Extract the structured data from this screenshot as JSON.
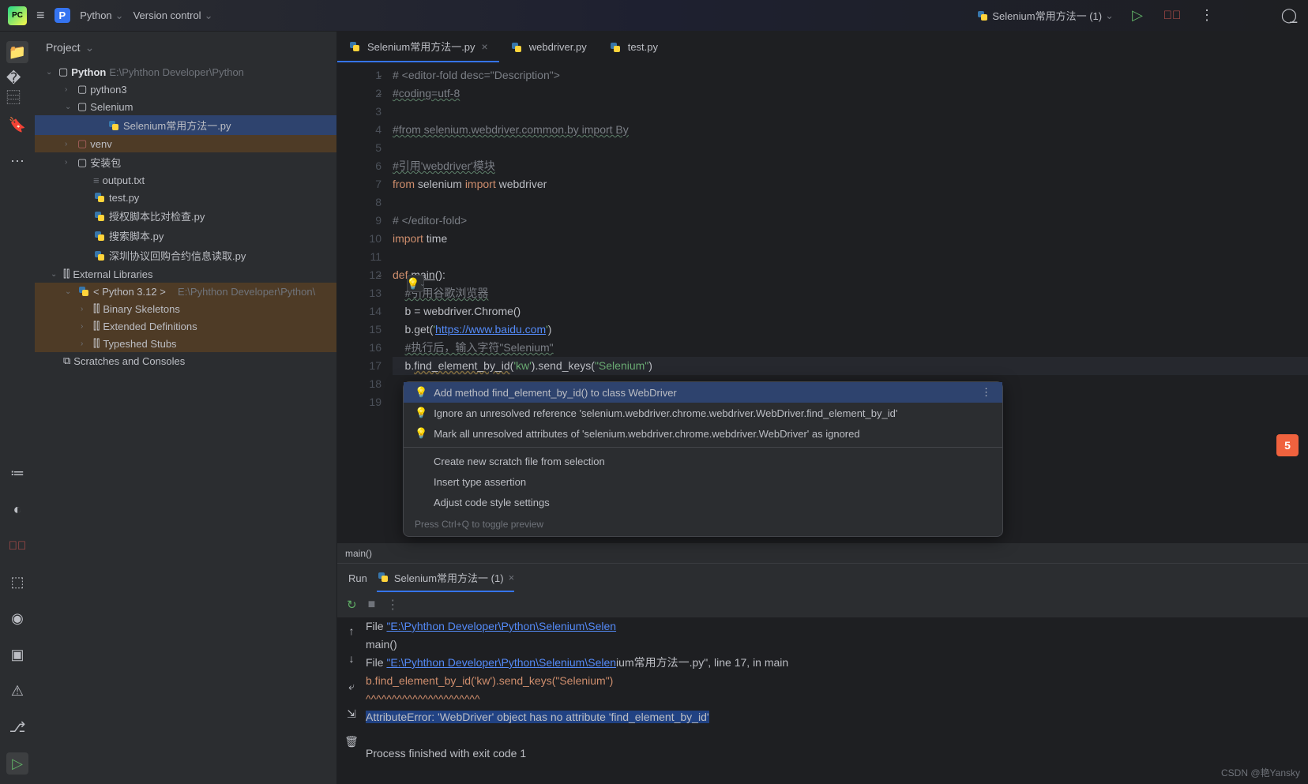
{
  "topbar": {
    "project_badge": "P",
    "project_name": "Python",
    "vcs": "Version control",
    "run_config": "Selenium常用方法一 (1)"
  },
  "project_panel": {
    "title": "Project",
    "root_name": "Python",
    "root_path": "E:\\Pyhthon Developer\\Python",
    "items": [
      {
        "indent": 24,
        "chevron": "›",
        "icon": "folder",
        "name": "python3"
      },
      {
        "indent": 24,
        "chevron": "⌄",
        "icon": "folder",
        "name": "Selenium"
      },
      {
        "indent": 62,
        "chevron": "",
        "icon": "py",
        "name": "Selenium常用方法一.py",
        "selected": true
      },
      {
        "indent": 24,
        "chevron": "›",
        "icon": "folder-excl",
        "name": "venv",
        "highlight": true
      },
      {
        "indent": 24,
        "chevron": "›",
        "icon": "folder",
        "name": "安装包"
      },
      {
        "indent": 44,
        "chevron": "",
        "icon": "txt",
        "name": "output.txt"
      },
      {
        "indent": 44,
        "chevron": "",
        "icon": "py",
        "name": "test.py"
      },
      {
        "indent": 44,
        "chevron": "",
        "icon": "py",
        "name": "授权脚本比对检查.py"
      },
      {
        "indent": 44,
        "chevron": "",
        "icon": "py",
        "name": "搜索脚本.py"
      },
      {
        "indent": 44,
        "chevron": "",
        "icon": "py",
        "name": "深圳协议回购合约信息读取.py"
      },
      {
        "indent": 6,
        "chevron": "⌄",
        "icon": "lib",
        "name": "External Libraries"
      },
      {
        "indent": 24,
        "chevron": "⌄",
        "icon": "py",
        "name": "< Python 3.12 >",
        "path": "E:\\Pyhthon Developer\\Python\\",
        "highlight": true
      },
      {
        "indent": 44,
        "chevron": "›",
        "icon": "lib",
        "name": "Binary Skeletons",
        "highlight": true
      },
      {
        "indent": 44,
        "chevron": "›",
        "icon": "lib",
        "name": "Extended Definitions",
        "highlight": true
      },
      {
        "indent": 44,
        "chevron": "›",
        "icon": "lib",
        "name": "Typeshed Stubs",
        "highlight": true
      },
      {
        "indent": 6,
        "chevron": "",
        "icon": "scratch",
        "name": "Scratches and Consoles"
      }
    ]
  },
  "tabs": [
    {
      "icon": "py",
      "name": "Selenium常用方法一.py",
      "active": true,
      "close": true
    },
    {
      "icon": "py",
      "name": "webdriver.py"
    },
    {
      "icon": "py",
      "name": "test.py"
    }
  ],
  "code": {
    "lines": [
      {
        "n": 1,
        "fold": "⌄",
        "html": "<span class='c-comment'># &lt;editor-fold desc=\"Description\"&gt;</span>"
      },
      {
        "n": 2,
        "fold": "⌄",
        "html": "<span class='c-comment-u'>#coding=utf-8</span>"
      },
      {
        "n": 3,
        "html": ""
      },
      {
        "n": 4,
        "html": "<span class='c-comment-u'>#from selenium.webdriver.common.by import By</span>"
      },
      {
        "n": 5,
        "html": ""
      },
      {
        "n": 6,
        "html": "<span class='c-comment-u'>#引用'webdriver'模块</span>"
      },
      {
        "n": 7,
        "html": "<span class='c-kw'>from</span> selenium <span class='c-kw'>import</span> webdriver"
      },
      {
        "n": 8,
        "html": ""
      },
      {
        "n": 9,
        "html": "<span class='c-comment'># &lt;/editor-fold&gt;</span>"
      },
      {
        "n": 10,
        "html": "<span class='c-kw'>import</span> time"
      },
      {
        "n": 11,
        "html": ""
      },
      {
        "n": 12,
        "fold": "⌄",
        "html": "<span class='c-kw'>def</span> <span class='c-func'>main</span>():"
      },
      {
        "n": 13,
        "html": "    <span class='c-comment-u'>#引用谷歌浏览器</span>"
      },
      {
        "n": 14,
        "html": "    b = webdriver.Chrome()"
      },
      {
        "n": 15,
        "html": "    b.get(<span class='c-str'>'</span><span class='c-str-link'>https://www.baidu.com</span><span class='c-str'>'</span>)"
      },
      {
        "n": 16,
        "html": "    <span class='c-comment-u'>#执行后，输入字符\"Selenium\"</span>"
      },
      {
        "n": 17,
        "cur": true,
        "html": "    b.<span class='c-warn'>find_element_by_id</span>(<span class='c-str'>'kw'</span>).send_keys(<span class='c-str'>\"Selenium\"</span>)"
      },
      {
        "n": 18,
        "html": ""
      },
      {
        "n": 19,
        "html": ""
      }
    ]
  },
  "breadcrumb": "main()",
  "intention": {
    "items": [
      {
        "bulb": true,
        "text": "Add method find_element_by_id() to class WebDriver",
        "sel": true,
        "more": true
      },
      {
        "bulb": true,
        "text": "Ignore an unresolved reference 'selenium.webdriver.chrome.webdriver.WebDriver.find_element_by_id'"
      },
      {
        "bulb": true,
        "text": "Mark all unresolved attributes of 'selenium.webdriver.chrome.webdriver.WebDriver' as ignored"
      },
      {
        "sep": true
      },
      {
        "text": "Create new scratch file from selection"
      },
      {
        "text": "Insert type assertion"
      },
      {
        "text": "Adjust code style settings"
      }
    ],
    "hint": "Press Ctrl+Q to toggle preview"
  },
  "run": {
    "tab_run": "Run",
    "tab_config": "Selenium常用方法一 (1)",
    "output_lines": [
      {
        "html": "  File <span class='out-link'>\"E:\\Pyhthon Developer\\Python\\Selenium\\Selen</span>"
      },
      {
        "html": "    main()"
      },
      {
        "html": "  File <span class='out-link'>\"E:\\Pyhthon Developer\\Python\\Selenium\\Selen</span><span style='color:#bcbec4'>ium常用方法一.py\", line 17, in main</span>"
      },
      {
        "html": "    b.find_element_by_id('kw').send_keys(\"Selenium\")",
        "cls": "out-err"
      },
      {
        "html": "    ^^^^^^^^^^^^^^^^^^^^^^",
        "cls": "out-err"
      },
      {
        "html": "<span class='out-err-sel'>AttributeError: 'WebDriver' object has no attribute 'find_element_by_id'</span>"
      },
      {
        "html": ""
      },
      {
        "html": "Process finished with exit code 1"
      }
    ]
  },
  "watermark": "CSDN @艳Yansky"
}
